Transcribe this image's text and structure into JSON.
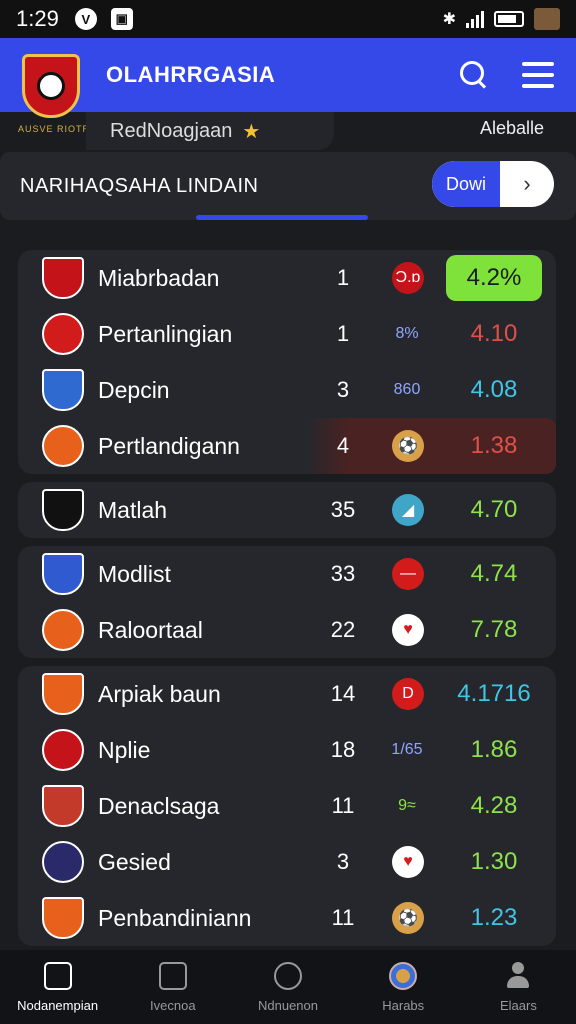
{
  "status_bar": {
    "time": "1:29"
  },
  "header": {
    "title": "OLAHRRGASIA"
  },
  "crest_caption": "AUSVE RIOTREB",
  "sub": {
    "label": "RedNoagjaan",
    "right": "Aleballe"
  },
  "section": {
    "title": "NARIHAQSAHA LINDAIN",
    "button": "Dowi"
  },
  "groups": [
    [
      {
        "name": "Miabrbadan",
        "num": "1",
        "mini": "Ɔ.ɒ",
        "value": "4.2%",
        "value_color": "#1b1c20",
        "value_bg": "#7ee23a",
        "logo_bg": "#c4141a",
        "mini_color": "#fff",
        "mini_bg": "#c4141a"
      },
      {
        "name": "Pertanlingian",
        "num": "1",
        "mini": "8%",
        "value": "4.10",
        "value_color": "#e0504a",
        "value_bg": "transparent",
        "logo_bg": "#d21c1c",
        "mini_color": "#8fa6ff",
        "mini_bg": "transparent"
      },
      {
        "name": "Depcin",
        "num": "3",
        "mini": "860",
        "value": "4.08",
        "value_color": "#3fc6e6",
        "value_bg": "transparent",
        "logo_bg": "#2f6ad0",
        "mini_color": "#8fa6ff",
        "mini_bg": "transparent"
      },
      {
        "name": "Pertlandigann",
        "num": "4",
        "mini": "⚽",
        "value": "1.38",
        "value_color": "#e0504a",
        "value_bg": "transparent",
        "logo_bg": "#e8611c",
        "mini_color": "#111",
        "mini_bg": "#d9a04a",
        "highlight": true
      }
    ],
    [
      {
        "name": "Matlah",
        "num": "35",
        "mini": "◢",
        "value": "4.70",
        "value_color": "#8ee24a",
        "value_bg": "transparent",
        "logo_bg": "#111",
        "mini_color": "#fff",
        "mini_bg": "#3fa6c8"
      }
    ],
    [
      {
        "name": "Modlist",
        "num": "33",
        "mini": "—",
        "value": "4.74",
        "value_color": "#8ee24a",
        "value_bg": "transparent",
        "logo_bg": "#2f5ad0",
        "mini_color": "#fff",
        "mini_bg": "#d21c1c"
      },
      {
        "name": "Raloortaal",
        "num": "22",
        "mini": "♥",
        "value": "7.78",
        "value_color": "#8ee24a",
        "value_bg": "transparent",
        "logo_bg": "#e8611c",
        "mini_color": "#d21c1c",
        "mini_bg": "#fff"
      }
    ],
    [
      {
        "name": "Arpiak baun",
        "num": "14",
        "mini": "D",
        "value": "4.1716",
        "value_color": "#3fc6e6",
        "value_bg": "transparent",
        "logo_bg": "#e8611c",
        "mini_color": "#fff",
        "mini_bg": "#d21c1c"
      },
      {
        "name": "Nplie",
        "num": "18",
        "mini": "1/65",
        "value": "1.86",
        "value_color": "#8ee24a",
        "value_bg": "transparent",
        "logo_bg": "#c4141a",
        "mini_color": "#8fa6ff",
        "mini_bg": "transparent"
      },
      {
        "name": "Denaclsaga",
        "num": "11",
        "mini": "9≈",
        "value": "4.28",
        "value_color": "#8ee24a",
        "value_bg": "transparent",
        "logo_bg": "#c43a2a",
        "mini_color": "#8ee24a",
        "mini_bg": "transparent"
      },
      {
        "name": "Gesied",
        "num": "3",
        "mini": "♥",
        "value": "1.30",
        "value_color": "#8ee24a",
        "value_bg": "transparent",
        "logo_bg": "#2a2a6a",
        "mini_color": "#d21c1c",
        "mini_bg": "#fff"
      },
      {
        "name": "Penbandiniann",
        "num": "11",
        "mini": "⚽",
        "value": "1.23",
        "value_color": "#3fc6e6",
        "value_bg": "transparent",
        "logo_bg": "#e8611c",
        "mini_color": "#111",
        "mini_bg": "#d9a04a"
      }
    ]
  ],
  "bottom_nav": [
    {
      "label": "Nodanempian",
      "icon": "home-icon",
      "active": true
    },
    {
      "label": "Ivecnoa",
      "icon": "book-icon",
      "active": false
    },
    {
      "label": "Ndnuenon",
      "icon": "search-icon",
      "active": false
    },
    {
      "label": "Harabs",
      "icon": "ball-icon",
      "active": false
    },
    {
      "label": "Elaars",
      "icon": "profile-icon",
      "active": false
    }
  ]
}
